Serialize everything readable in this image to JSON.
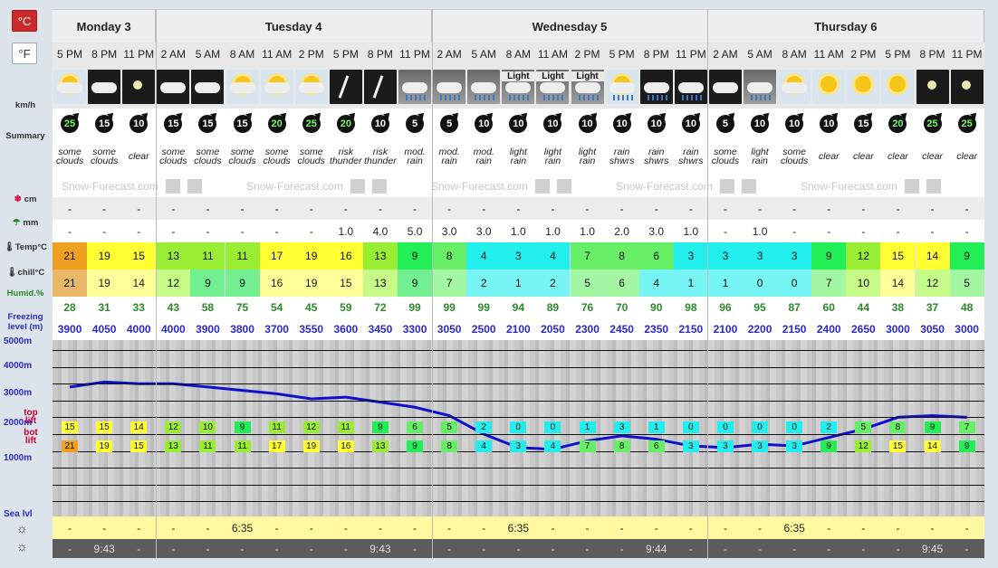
{
  "units": {
    "celsius": "°C",
    "fahrenheit": "°F"
  },
  "labels": {
    "wind": "km/h",
    "summary": "Summary",
    "snow": "cm",
    "rain": "mm",
    "temp": "Temp°C",
    "chill": "chill°C",
    "humid": "Humid.%",
    "freezing_1": "Freezing",
    "freezing_2": "level (m)",
    "top_1": "top",
    "top_2": "lift",
    "bot_1": "bot",
    "bot_2": "lift",
    "sea": "Sea lvl"
  },
  "altitudes": [
    "5000m",
    "4000m",
    "3000m",
    "2000m",
    "1000m"
  ],
  "watermark": "Snow-Forecast.com",
  "days": [
    {
      "label": "Monday 3",
      "span": 3
    },
    {
      "label": "Tuesday 4",
      "span": 8
    },
    {
      "label": "Wednesday 5",
      "span": 8
    },
    {
      "label": "Thursday 6",
      "span": 8
    }
  ],
  "times": [
    "5 PM",
    "8 PM",
    "11 PM",
    "2 AM",
    "5 AM",
    "8 AM",
    "11 AM",
    "2 PM",
    "5 PM",
    "8 PM",
    "11 PM",
    "2 AM",
    "5 AM",
    "8 AM",
    "11 AM",
    "2 PM",
    "5 PM",
    "8 PM",
    "11 PM",
    "2 AM",
    "5 AM",
    "8 AM",
    "11 AM",
    "2 PM",
    "5 PM",
    "8 PM",
    "11 PM"
  ],
  "icons": [
    "some-clouds-day-icon",
    "some-clouds-night-icon",
    "clear-night-icon",
    "some-clouds-night-icon",
    "some-clouds-night-icon",
    "some-clouds-day-icon",
    "some-clouds-day-icon",
    "some-clouds-day-icon",
    "thunder-icon",
    "thunder-icon",
    "rain-icon",
    "rain-icon",
    "rain-icon",
    "light-rain-icon",
    "light-rain-icon",
    "light-rain-icon",
    "showers-day-icon",
    "showers-night-icon",
    "showers-night-icon",
    "some-clouds-night-icon",
    "rain-night-icon",
    "some-clouds-day-icon",
    "sunny-icon",
    "sunny-icon",
    "sunny-icon",
    "clear-night-icon",
    "clear-night-icon"
  ],
  "icon_text": [
    "",
    "",
    "",
    "",
    "",
    "",
    "",
    "",
    "",
    "",
    "",
    "",
    "",
    "Light",
    "Light",
    "Light",
    "",
    "",
    "",
    "",
    "",
    "",
    "",
    "",
    "",
    "",
    ""
  ],
  "wind": [
    "25",
    "15",
    "10",
    "15",
    "15",
    "15",
    "20",
    "25",
    "20",
    "10",
    "5",
    "5",
    "10",
    "10",
    "10",
    "10",
    "10",
    "10",
    "10",
    "5",
    "10",
    "10",
    "10",
    "15",
    "20",
    "25",
    "25"
  ],
  "summary": [
    "some clouds",
    "some clouds",
    "clear",
    "some clouds",
    "some clouds",
    "some clouds",
    "some clouds",
    "some clouds",
    "risk thunder",
    "risk thunder",
    "mod. rain",
    "mod. rain",
    "mod. rain",
    "light rain",
    "light rain",
    "light rain",
    "rain shwrs",
    "rain shwrs",
    "rain shwrs",
    "some clouds",
    "light rain",
    "some clouds",
    "clear",
    "clear",
    "clear",
    "clear",
    "clear"
  ],
  "snow": [
    "-",
    "-",
    "-",
    "-",
    "-",
    "-",
    "-",
    "-",
    "-",
    "-",
    "-",
    "-",
    "-",
    "-",
    "-",
    "-",
    "-",
    "-",
    "-",
    "-",
    "-",
    "-",
    "-",
    "-",
    "-",
    "-",
    "-"
  ],
  "rain": [
    "-",
    "-",
    "-",
    "-",
    "-",
    "-",
    "-",
    "-",
    "1.0",
    "4.0",
    "5.0",
    "3.0",
    "3.0",
    "1.0",
    "1.0",
    "1.0",
    "2.0",
    "3.0",
    "1.0",
    "-",
    "1.0",
    "-",
    "-",
    "-",
    "-",
    "-",
    "-"
  ],
  "temp": [
    "21",
    "19",
    "15",
    "13",
    "11",
    "11",
    "17",
    "19",
    "16",
    "13",
    "9",
    "8",
    "4",
    "3",
    "4",
    "7",
    "8",
    "6",
    "3",
    "3",
    "3",
    "3",
    "9",
    "12",
    "15",
    "14",
    "9"
  ],
  "chill": [
    "21",
    "19",
    "14",
    "12",
    "9",
    "9",
    "16",
    "19",
    "15",
    "13",
    "9",
    "7",
    "2",
    "1",
    "2",
    "5",
    "6",
    "4",
    "1",
    "1",
    "0",
    "0",
    "7",
    "10",
    "14",
    "12",
    "5"
  ],
  "humidity": [
    "28",
    "31",
    "33",
    "43",
    "58",
    "75",
    "54",
    "45",
    "59",
    "72",
    "99",
    "99",
    "99",
    "94",
    "89",
    "76",
    "70",
    "90",
    "98",
    "96",
    "95",
    "87",
    "60",
    "44",
    "38",
    "37",
    "48"
  ],
  "freezing": [
    "3900",
    "4050",
    "4000",
    "4000",
    "3900",
    "3800",
    "3700",
    "3550",
    "3600",
    "3450",
    "3300",
    "3050",
    "2500",
    "2100",
    "2050",
    "2300",
    "2450",
    "2350",
    "2150",
    "2100",
    "2200",
    "2150",
    "2400",
    "2650",
    "3000",
    "3050",
    "3000"
  ],
  "top_lift": [
    "15",
    "15",
    "14",
    "12",
    "10",
    "9",
    "11",
    "12",
    "11",
    "9",
    "6",
    "5",
    "2",
    "0",
    "0",
    "1",
    "3",
    "1",
    "0",
    "0",
    "0",
    "0",
    "2",
    "5",
    "8",
    "9",
    "7"
  ],
  "bot_lift": [
    "21",
    "19",
    "15",
    "13",
    "11",
    "11",
    "17",
    "19",
    "16",
    "13",
    "9",
    "8",
    "4",
    "3",
    "4",
    "7",
    "8",
    "6",
    "3",
    "3",
    "3",
    "3",
    "9",
    "12",
    "15",
    "14",
    "9"
  ],
  "sunrise": [
    "-",
    "-",
    "-",
    "-",
    "-",
    "6:35",
    "-",
    "-",
    "-",
    "-",
    "-",
    "-",
    "-",
    "6:35",
    "-",
    "-",
    "-",
    "-",
    "-",
    "-",
    "-",
    "6:35",
    "-",
    "-",
    "-",
    "-",
    "-"
  ],
  "sunset": [
    "-",
    "9:43",
    "-",
    "-",
    "-",
    "-",
    "-",
    "-",
    "-",
    "9:43",
    "-",
    "-",
    "-",
    "-",
    "-",
    "-",
    "-",
    "9:44",
    "-",
    "-",
    "-",
    "-",
    "-",
    "-",
    "-",
    "9:45",
    "-"
  ],
  "colors": {
    "hot": "#f0a020",
    "warm_yellow": "#ffff33",
    "light_yellow": "#ffee88",
    "lime": "#99ee33",
    "green": "#22ee55",
    "green2": "#66ee66",
    "cyan": "#22eeee",
    "cyan2": "#33ddee",
    "line": "#1010cc"
  }
}
